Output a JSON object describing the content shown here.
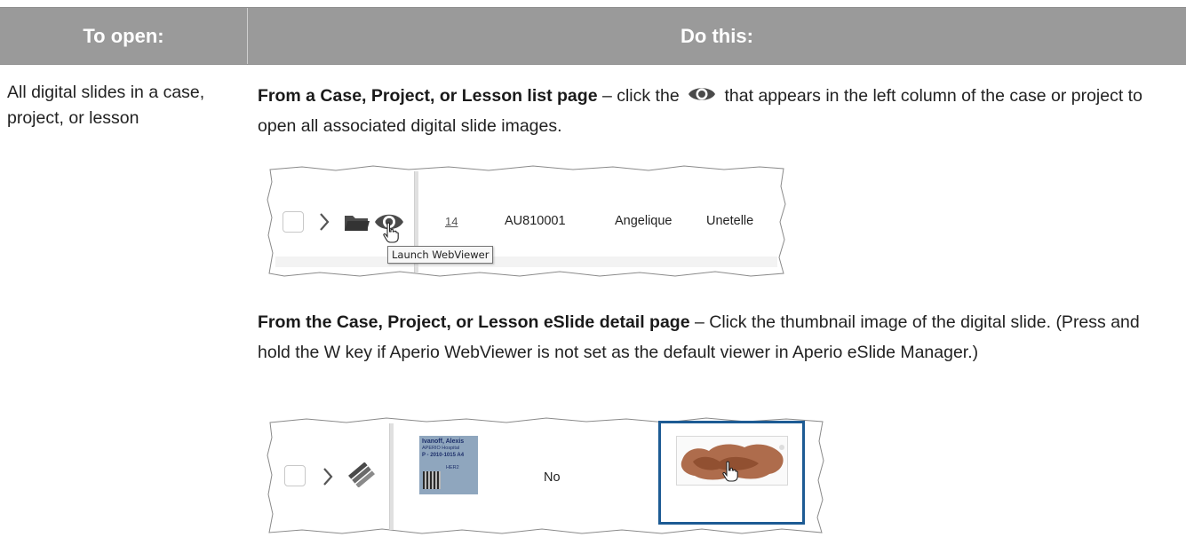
{
  "table": {
    "header": {
      "col1": "To open:",
      "col2": "Do this:"
    },
    "row": {
      "col1_text": "All digital slides in a case, project, or lesson",
      "para1": {
        "bold": "From a Case, Project, or Lesson list page",
        "text_before_icon": " – click the ",
        "text_after_icon": " that appears in the left column of the case or project to open all associated digital slide images.",
        "icon": "eye-icon"
      },
      "para2": {
        "bold": "From the Case, Project, or Lesson eSlide detail page",
        "text": " – Click the thumbnail image of the digital slide. (Press and hold the W key if Aperio WebViewer is not set as the default viewer in Aperio eSlide Manager.)"
      }
    }
  },
  "screenshot1": {
    "row": {
      "count": "14",
      "id": "AU810001",
      "first_name": "Angelique",
      "last_name": "Unetelle"
    },
    "tooltip": "Launch WebViewer",
    "icons": [
      "checkbox",
      "chevron-right-icon",
      "folder-icon",
      "eye-icon",
      "hand-pointer-icon"
    ]
  },
  "screenshot2": {
    "label": {
      "name": "Ivanoff, Alexis",
      "hospital": "APERIO Hospital",
      "specimen": "P - 2010-1015 A4",
      "stain": "HER2"
    },
    "value": "No",
    "icons": [
      "checkbox",
      "chevron-right-icon",
      "slides-stack-icon",
      "hand-pointer-icon"
    ]
  },
  "colors": {
    "header_bg": "#9a9a9a",
    "header_text": "#ffffff",
    "highlight_border": "#1d5b94",
    "label_bg": "#8fa6be",
    "tissue": "#a0522d"
  }
}
